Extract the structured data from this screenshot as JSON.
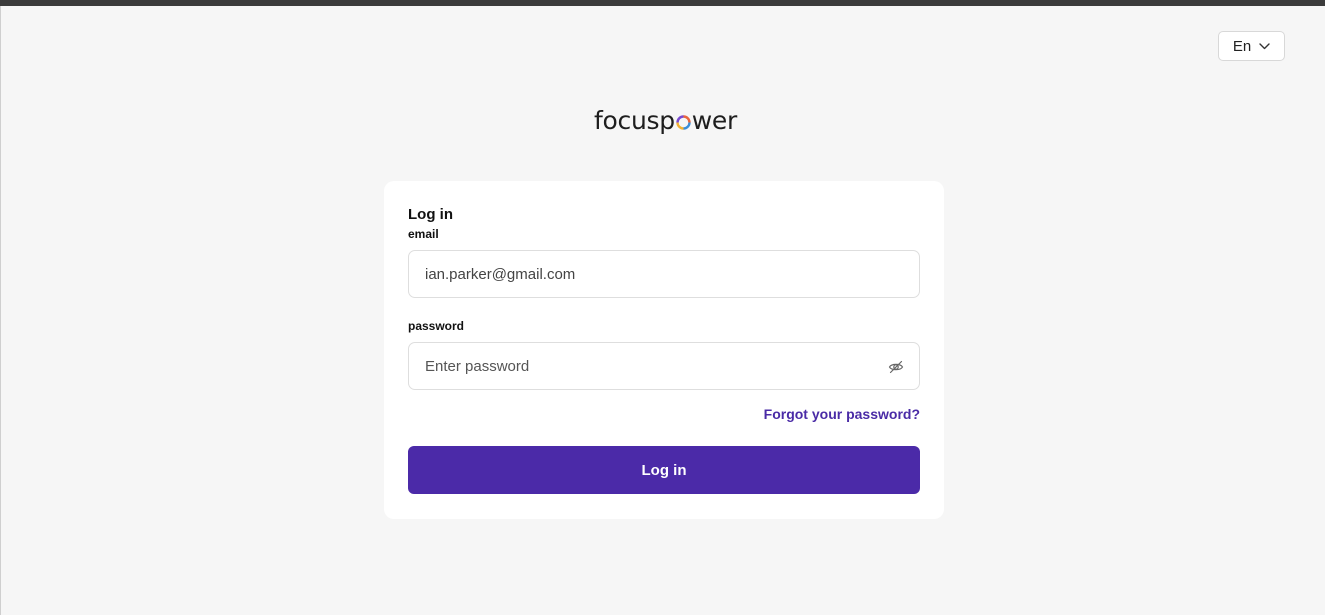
{
  "language": {
    "selected": "En",
    "icon": "chevron-down-icon"
  },
  "logo": {
    "text_before": "focusp",
    "text_after": "wer",
    "o_colors": [
      "#e8663d",
      "#3a8fd9",
      "#f2b134",
      "#7a4bd1"
    ]
  },
  "login": {
    "title": "Log in",
    "email_label": "email",
    "email_value": "ian.parker@gmail.com",
    "password_label": "password",
    "password_placeholder": "Enter password",
    "password_toggle_icon": "eye-off-icon",
    "forgot_label": "Forgot your password?",
    "submit_label": "Log in"
  },
  "colors": {
    "accent": "#4b2aa8",
    "link": "#4a2ba6",
    "background": "#f6f6f6"
  }
}
